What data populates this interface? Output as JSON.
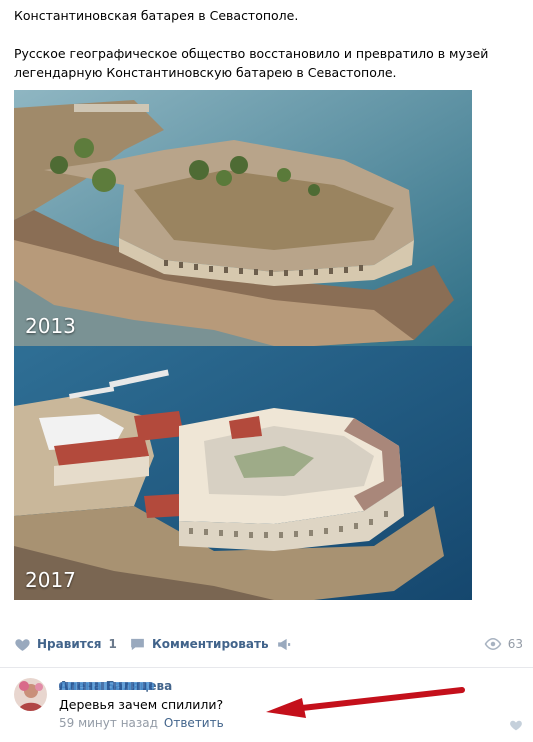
{
  "post": {
    "title": "Константиновская батарея в Севастополе.",
    "body": "Русское географическое общество восстановило и превратило в музей легендарную Константиновскую батарею в Севастополе.",
    "photos": [
      {
        "year": "2013"
      },
      {
        "year": "2017"
      }
    ]
  },
  "actions": {
    "like_label": "Нравится",
    "like_count": "1",
    "comment_label": "Комментировать",
    "views_count": "63",
    "icons": {
      "like": "heart-icon",
      "comment": "comment-icon",
      "share": "megaphone-icon",
      "views": "eye-icon"
    }
  },
  "comment": {
    "author": "Алена Баляцева",
    "text": "Деревья зачем спилили?",
    "time": "59 минут назад",
    "reply_label": "Ответить"
  },
  "colors": {
    "link": "#42648b",
    "muted": "#939ba6",
    "arrow": "#c4101b",
    "divider": "#e7e8ec"
  }
}
